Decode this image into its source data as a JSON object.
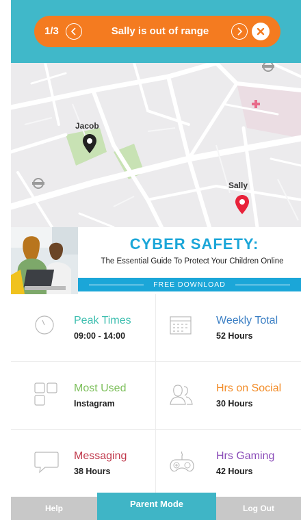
{
  "alert": {
    "counter": "1/3",
    "message": "Sally is out of range"
  },
  "map": {
    "pins": [
      {
        "name": "Jacob",
        "color": "#222222"
      },
      {
        "name": "Sally",
        "color": "#e8223a"
      }
    ]
  },
  "banner": {
    "title": "CYBER SAFETY:",
    "subtitle": "The Essential Guide To Protect Your Children Online",
    "cta": "FREE DOWNLOAD"
  },
  "stats": [
    {
      "title": "Peak Times",
      "value": "09:00 - 14:00",
      "color": "#3fbfb0",
      "icon": "clock-icon"
    },
    {
      "title": "Weekly Total",
      "value": "52 Hours",
      "color": "#3b7fc4",
      "icon": "calendar-icon"
    },
    {
      "title": "Most Used",
      "value": "Instagram",
      "color": "#7cbf5a",
      "icon": "apps-grid-icon"
    },
    {
      "title": "Hrs on Social",
      "value": "30 Hours",
      "color": "#f28c28",
      "icon": "social-users-icon"
    },
    {
      "title": "Messaging",
      "value": "38 Hours",
      "color": "#c0384b",
      "icon": "chat-bubble-icon"
    },
    {
      "title": "Hrs Gaming",
      "value": "42 Hours",
      "color": "#8a4bb8",
      "icon": "gamepad-icon"
    }
  ],
  "tabs": {
    "help": "Help",
    "parent_mode": "Parent Mode",
    "logout": "Log Out"
  },
  "colors": {
    "header": "#40b8c9",
    "alert": "#f47b20",
    "banner_accent": "#1ba6d8"
  }
}
